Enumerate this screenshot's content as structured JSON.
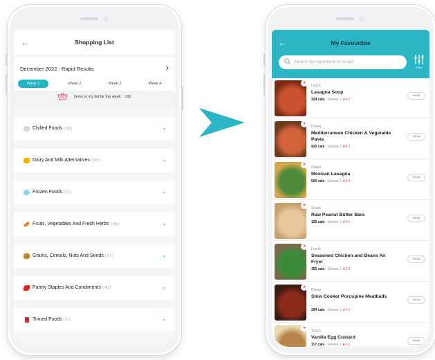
{
  "colors": {
    "accent": "#23b3c2",
    "header_teal": "#2cb6c5",
    "heart": "#e84c6d"
  },
  "shopping_list": {
    "title": "Shopping List",
    "period": "December 2022 - Rapid Results",
    "weeks": [
      "Week 1",
      "Week 2",
      "Week 3",
      "Week 4"
    ],
    "active_week": 0,
    "items_label": "Items in my list for the week:",
    "items_count": "132",
    "categories": [
      {
        "name": "Chilled Foods",
        "count": "( 10 )",
        "icon": "chilled-foods-icon"
      },
      {
        "name": "Dairy And Milk Alternatives",
        "count": "( 10 )",
        "icon": "cheese-icon"
      },
      {
        "name": "Frozen Foods",
        "count": "( 2 )",
        "icon": "snowflake-icon"
      },
      {
        "name": "Fruits, Vegetables And Fresh Herbs",
        "count": "( 43 )",
        "icon": "carrot-icon"
      },
      {
        "name": "Grains, Cereals, Nuts And Seeds",
        "count": "( 17 )",
        "icon": "grains-icon"
      },
      {
        "name": "Pantry Staples And Condiments",
        "count": "( 45 )",
        "icon": "chili-icon"
      },
      {
        "name": "Tinned Foods",
        "count": "( 5 )",
        "icon": "tin-can-icon"
      }
    ]
  },
  "favourites": {
    "title": "My Favourites",
    "search_placeholder": "Search by ingredient or recipe",
    "filter_label": "Filter",
    "swap_label": "swap",
    "recipes": [
      {
        "meal": "Lunch",
        "name": "Lasagna Soup",
        "cals": "324 cals",
        "serves": "- Serves 1",
        "rating": "4.6"
      },
      {
        "meal": "Dinner",
        "name": "Mediterranean Chicken & Vegetable Pasta",
        "cals": "425 cals",
        "serves": "- Serves 1",
        "rating": "4.1"
      },
      {
        "meal": "Dinner",
        "name": "Mexican Lasagna",
        "cals": "505 cals",
        "serves": "- Serves 1",
        "rating": "4.8"
      },
      {
        "meal": "Snack",
        "name": "Raw Peanut Butter Bars",
        "cals": "135 cals",
        "serves": "- Serves 1",
        "rating": "4.6"
      },
      {
        "meal": "Lunch",
        "name": "Seasoned Chicken and Beans Air Fryer",
        "cals": "355 cals",
        "serves": "- Serves 1",
        "rating": "3.8"
      },
      {
        "meal": "Dinner",
        "name": "Slow Cooker Porcupine Meatballs",
        "cals": "294 cals",
        "serves": "- Serves 1",
        "rating": "4.5"
      },
      {
        "meal": "Snack",
        "name": "Vanilla Egg Custard",
        "cals": "117 cals",
        "serves": "- Serves 1",
        "rating": "4.2"
      }
    ]
  }
}
